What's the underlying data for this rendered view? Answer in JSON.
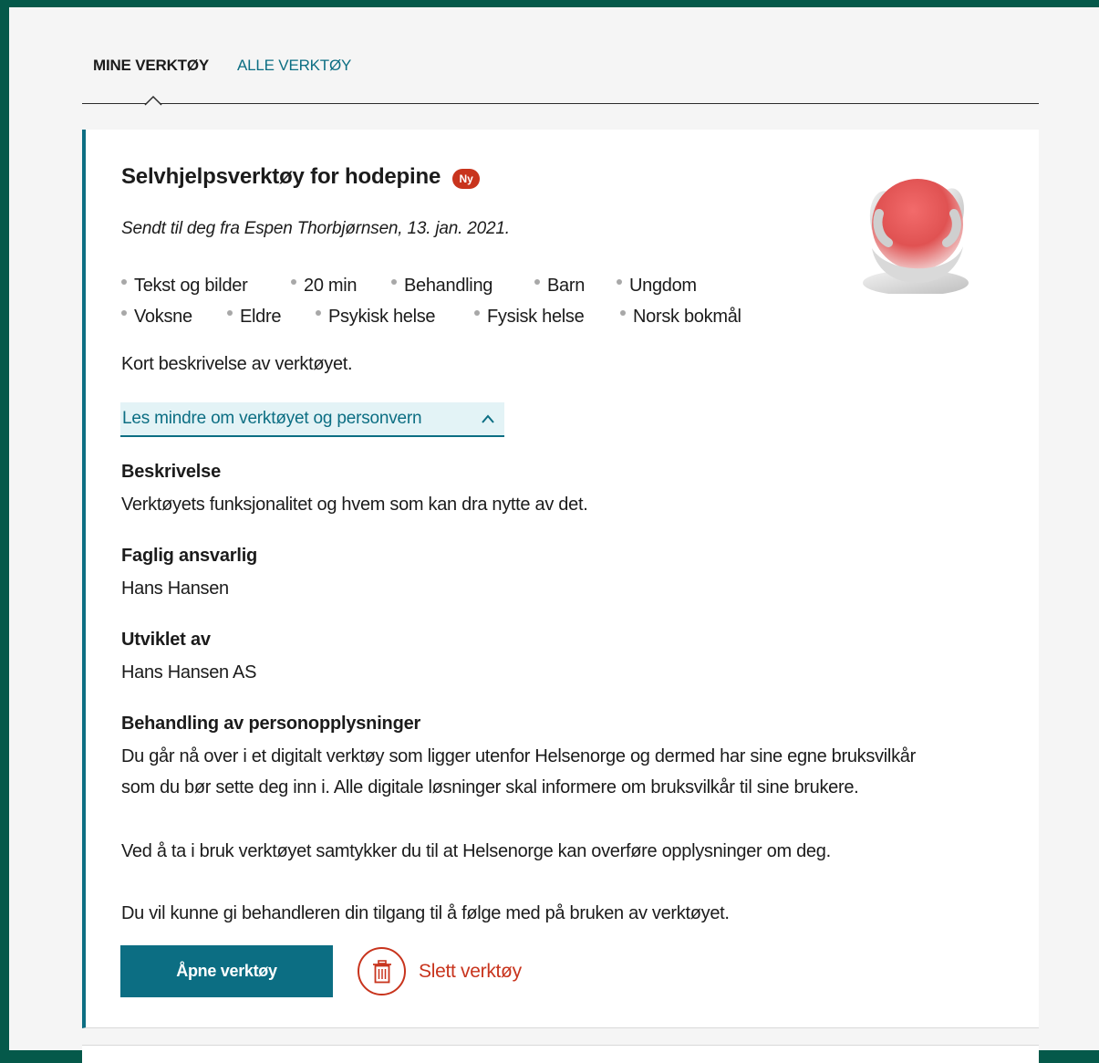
{
  "tabs": {
    "mine": "MINE VERKTØY",
    "alle": "ALLE VERKTØY"
  },
  "card": {
    "title": "Selvhjelpsverktøy for hodepine",
    "badge": "Ny",
    "sender": "Sendt til deg fra Espen Thorbjørnsen, 13. jan. 2021.",
    "tags_row1": [
      "Tekst og bilder",
      "20 min",
      "Behandling",
      "Barn",
      "Ungdom"
    ],
    "tags_row2": [
      "Voksne",
      "Eldre",
      "Psykisk helse",
      "Fysisk helse",
      "Norsk bokmål"
    ],
    "short_description": "Kort beskrivelse av verktøyet.",
    "toggle_label": "Les mindre om verktøyet og personvern",
    "sections": {
      "beskrivelse_heading": "Beskrivelse",
      "beskrivelse_text": "Verktøyets funksjonalitet og hvem som kan dra nytte av det.",
      "faglig_heading": "Faglig ansvarlig",
      "faglig_text": "Hans Hansen",
      "utviklet_heading": "Utviklet av",
      "utviklet_text": "Hans Hansen AS",
      "personopplysninger_heading": "Behandling av personopplysninger",
      "personopplysninger_p1_line1": "Du går nå over i et digitalt verktøy som ligger utenfor Helsenorge og dermed har sine egne bruksvilkår",
      "personopplysninger_p1_line2": "som du bør sette deg inn i. Alle digitale løsninger skal informere om bruksvilkår til sine brukere.",
      "personopplysninger_p2": "Ved å ta i bruk verktøyet samtykker du til at Helsenorge kan overføre opplysninger om deg.",
      "personopplysninger_p3": "Du vil kunne gi behandleren din tilgang til å følge med på bruken av verktøyet."
    },
    "open_button": "Åpne verktøy",
    "delete_button": "Slett verktøy"
  },
  "colors": {
    "page_background": "#05594a",
    "accent": "#0c6e83",
    "danger": "#c8341d",
    "badge": "#c8341d"
  },
  "icons": {
    "toggle": "chevron-up-icon",
    "delete": "trash-icon",
    "tab_indicator": "caret-up-icon"
  }
}
